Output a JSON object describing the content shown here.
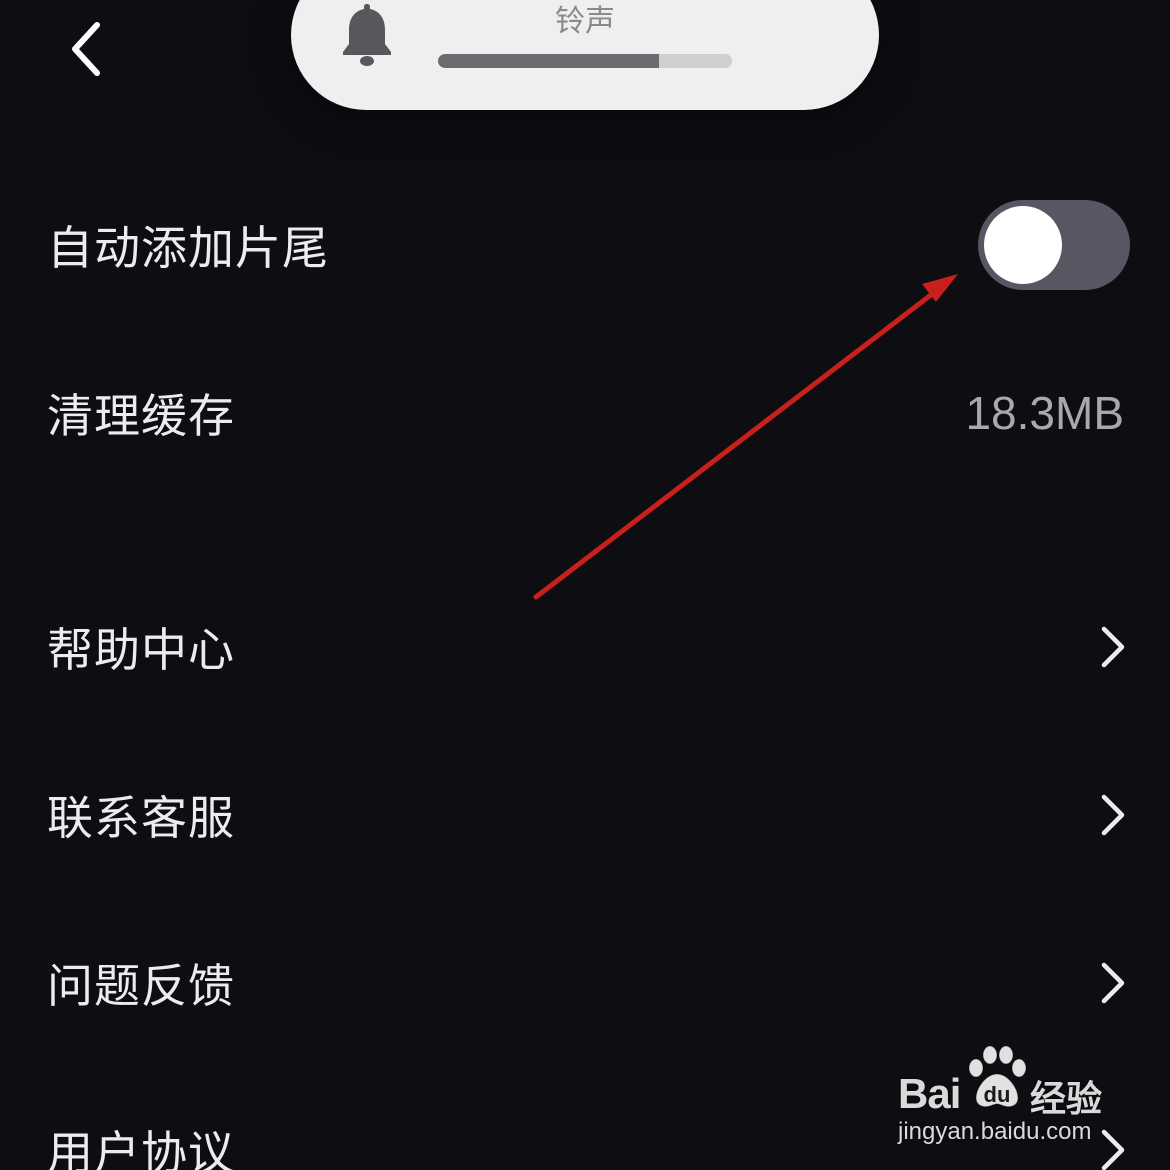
{
  "volume_hud": {
    "label": "铃声",
    "level_percent": 75,
    "icon": "bell-icon"
  },
  "nav": {
    "back_icon": "chevron-left-icon"
  },
  "settings": {
    "auto_outro": {
      "label": "自动添加片尾",
      "enabled": false
    },
    "clear_cache": {
      "label": "清理缓存",
      "value": "18.3MB"
    },
    "help_center": {
      "label": "帮助中心"
    },
    "contact_service": {
      "label": "联系客服"
    },
    "feedback": {
      "label": "问题反馈"
    },
    "user_agreement": {
      "label": "用户协议"
    }
  },
  "watermark": {
    "brand": "Bai",
    "brand_suffix": "du",
    "name_cn": "经验",
    "url": "jingyan.baidu.com"
  },
  "colors": {
    "background": "#0e0d12",
    "text": "#ecebf0",
    "toggle_off": "#575662",
    "annotation_arrow": "#c8201b"
  }
}
